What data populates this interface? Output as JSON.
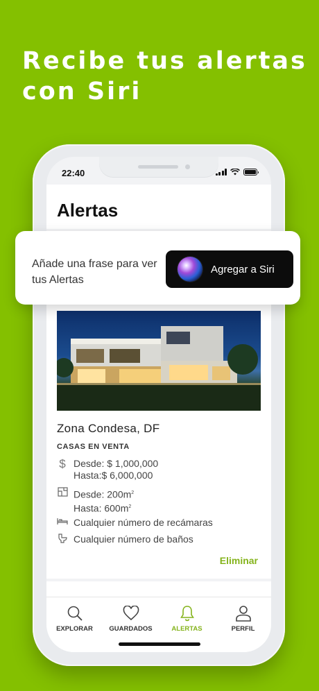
{
  "headline": {
    "line1": "Recibe tus alertas",
    "line2": "con Siri"
  },
  "status_bar": {
    "time": "22:40"
  },
  "page": {
    "title": "Alertas"
  },
  "siri_banner": {
    "text": "Añade una frase para ver tus Alertas",
    "button_label": "Agregar a Siri"
  },
  "alert_card": {
    "title": "Zona Condesa, DF",
    "subtitle": "CASAS  EN VENTA",
    "price_from": "Desde: $ 1,000,000",
    "price_to": "Hasta:$ 6,000,000",
    "area_from": "Desde: 200m",
    "area_to": "Hasta: 600m",
    "area_unit_exp": "2",
    "bedrooms": "Cualquier número de recámaras",
    "bathrooms": "Cualquier número de baños",
    "delete_label": "Eliminar",
    "icons": [
      "dollar-icon",
      "floor-plan-icon",
      "bed-icon",
      "toilet-icon"
    ]
  },
  "tabs": [
    {
      "label": "EXPLORAR",
      "icon": "search-icon"
    },
    {
      "label": "GUARDADOS",
      "icon": "heart-icon"
    },
    {
      "label": "ALERTAS",
      "icon": "bell-icon",
      "active": true
    },
    {
      "label": "PERFIL",
      "icon": "user-icon"
    }
  ],
  "colors": {
    "brand_green": "#84c000",
    "accent_green": "#84b31b",
    "siri_button": "#0c0c0c"
  }
}
